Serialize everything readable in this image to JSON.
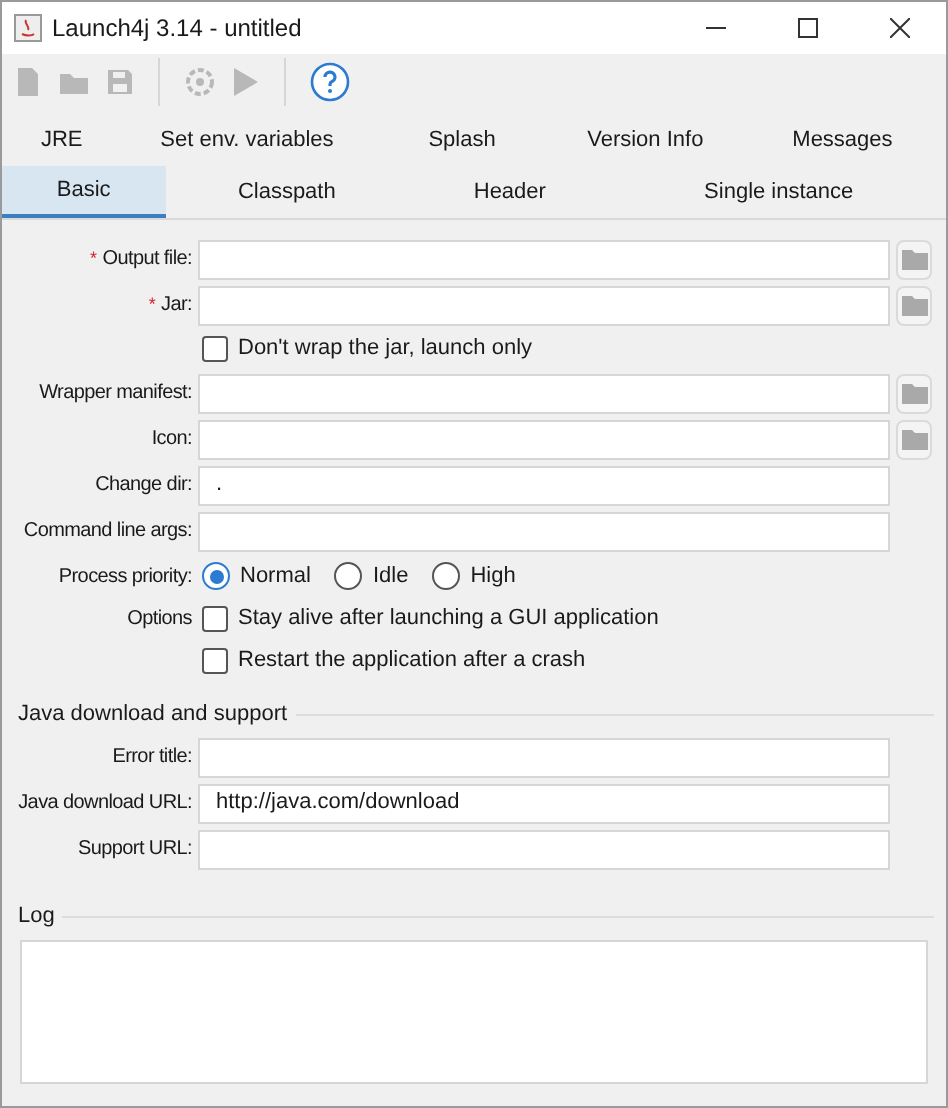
{
  "window": {
    "title": "Launch4j 3.14 - untitled"
  },
  "toolbar": [
    {
      "kind": "new",
      "disabled": true
    },
    {
      "kind": "open",
      "disabled": true
    },
    {
      "kind": "save",
      "disabled": true
    },
    {
      "kind": "separator"
    },
    {
      "kind": "build",
      "disabled": true
    },
    {
      "kind": "run",
      "disabled": true
    },
    {
      "kind": "separator"
    },
    {
      "kind": "help",
      "disabled": false
    }
  ],
  "tab_rows": [
    [
      {
        "label": "JRE",
        "selected": false
      },
      {
        "label": "Set env. variables",
        "selected": false
      },
      {
        "label": "Splash",
        "selected": false
      },
      {
        "label": "Version Info",
        "selected": false
      },
      {
        "label": "Messages",
        "selected": false
      }
    ],
    [
      {
        "label": "Basic",
        "selected": true
      },
      {
        "label": "Classpath",
        "selected": false
      },
      {
        "label": "Header",
        "selected": false
      },
      {
        "label": "Single instance",
        "selected": false
      }
    ]
  ],
  "form": [
    {
      "kind": "field",
      "required_mark": "*",
      "label": "Output file:",
      "browse": true
    },
    {
      "kind": "field",
      "required_mark": "*",
      "label": "Jar:",
      "browse": true
    },
    {
      "kind": "checkbox",
      "text": "Don't wrap the jar, launch only",
      "checked": false
    },
    {
      "kind": "field",
      "label": "Wrapper manifest:",
      "browse": true
    },
    {
      "kind": "field",
      "label": "Icon:",
      "browse": true
    },
    {
      "kind": "field",
      "label": "Change dir:",
      "value": ".",
      "browse": false
    },
    {
      "kind": "field",
      "label": "Command line args:",
      "browse": false
    },
    {
      "kind": "radio",
      "label": "Process priority:",
      "options": [
        {
          "label": "Normal",
          "selected": true
        },
        {
          "label": "Idle",
          "selected": false
        },
        {
          "label": "High",
          "selected": false
        }
      ]
    },
    {
      "kind": "checkbox",
      "label": "Options",
      "text": "Stay alive after launching a GUI application",
      "checked": false
    },
    {
      "kind": "checkbox",
      "text": "Restart the application after a crash",
      "checked": false
    }
  ],
  "java_download": {
    "title": "Java download and support",
    "rows": [
      {
        "kind": "field",
        "label": "Error title:",
        "browse": false
      },
      {
        "kind": "field",
        "label": "Java download URL:",
        "value": "http://java.com/download",
        "browse": false
      },
      {
        "kind": "field",
        "label": "Support URL:",
        "browse": false
      }
    ]
  },
  "log": {
    "title": "Log"
  }
}
